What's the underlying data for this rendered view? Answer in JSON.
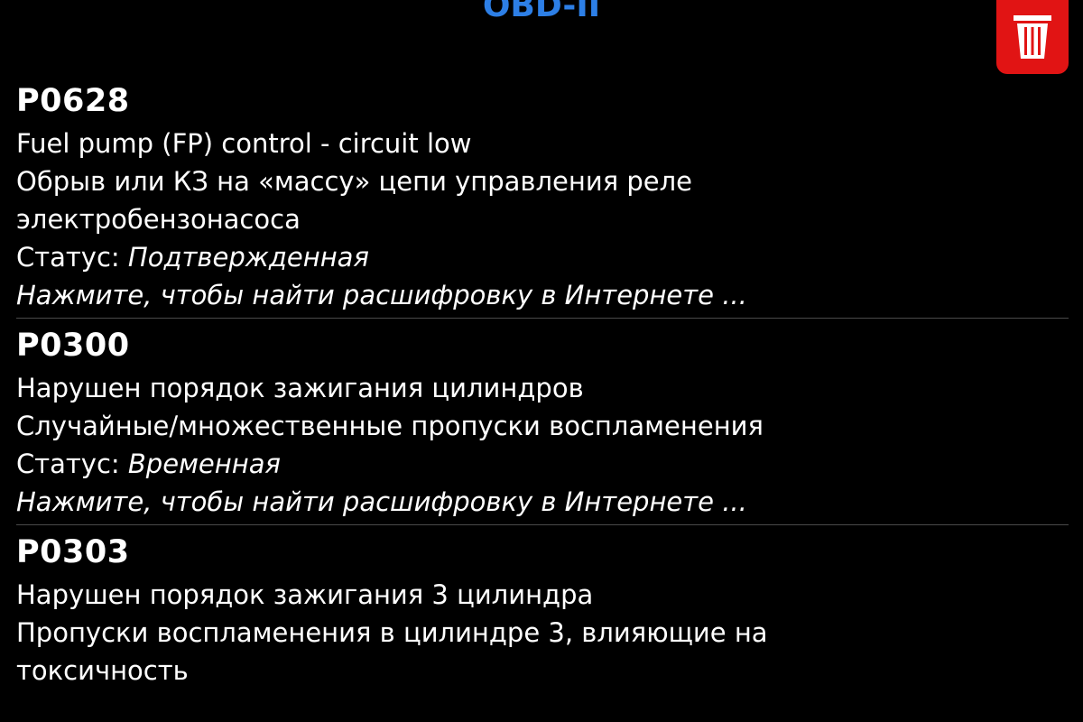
{
  "header": {
    "title": "OBD-II",
    "trash_icon": "trash-icon",
    "accent_color": "#2d7fe6",
    "trash_color": "#e11414"
  },
  "dtc_items": [
    {
      "code": "P0628",
      "lines": [
        "Fuel pump (FP) control - circuit low",
        "Обрыв или КЗ на «массу» цепи управления реле электробензонасоса"
      ],
      "status_label": "Статус: ",
      "status_value": "Подтвержденная",
      "link": "Нажмите, чтобы найти расшифровку в Интернете ..."
    },
    {
      "code": "P0300",
      "lines": [
        "Нарушен порядок зажигания цилиндров",
        "Случайные/множественные пропуски воспламенения"
      ],
      "status_label": "Статус: ",
      "status_value": "Временная",
      "link": "Нажмите, чтобы найти расшифровку в Интернете ..."
    },
    {
      "code": "P0303",
      "lines": [
        "Нарушен порядок зажигания 3 цилиндра",
        "Пропуски воспламенения в цилиндре 3, влияющие на токсичность"
      ]
    }
  ]
}
